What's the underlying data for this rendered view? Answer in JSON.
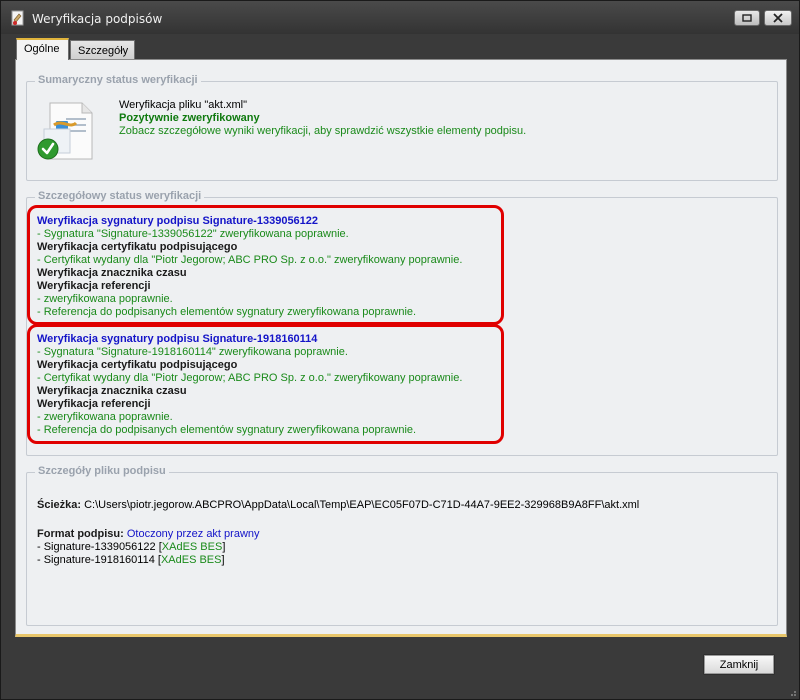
{
  "window": {
    "title": "Weryfikacja podpisów"
  },
  "tabs": [
    {
      "label": "Ogólne",
      "active": true
    },
    {
      "label": "Szczegóły",
      "active": false
    }
  ],
  "summary": {
    "legend": "Sumaryczny status weryfikacji",
    "file_line": "Weryfikacja pliku \"akt.xml\"",
    "status": "Pozytywnie zweryfikowany",
    "hint": "Zobacz szczegółowe wyniki weryfikacji, aby sprawdzić wszystkie elementy podpisu."
  },
  "details": {
    "legend": "Szczegółowy status weryfikacji",
    "signatures": [
      {
        "heading": "Weryfikacja sygnatury podpisu Signature-1339056122",
        "sig_result": " - Sygnatura \"Signature-1339056122\" zweryfikowana poprawnie.",
        "cert_heading": "Weryfikacja certyfikatu podpisującego",
        "cert_result": " - Certyfikat wydany dla \"Piotr Jegorow; ABC PRO Sp. z o.o.\" zweryfikowany poprawnie.",
        "timestamp_heading": "Weryfikacja znacznika czasu",
        "ref_heading": "Weryfikacja referencji",
        "ref_result1": " -  zweryfikowana poprawnie.",
        "ref_result2": " - Referencja do podpisanych elementów sygnatury zweryfikowana poprawnie."
      },
      {
        "heading": "Weryfikacja sygnatury podpisu Signature-1918160114",
        "sig_result": " - Sygnatura \"Signature-1918160114\" zweryfikowana poprawnie.",
        "cert_heading": "Weryfikacja certyfikatu podpisującego",
        "cert_result": " - Certyfikat wydany dla \"Piotr Jegorow; ABC PRO Sp. z o.o.\" zweryfikowany poprawnie.",
        "timestamp_heading": "Weryfikacja znacznika czasu",
        "ref_heading": "Weryfikacja referencji",
        "ref_result1": " -  zweryfikowana poprawnie.",
        "ref_result2": " - Referencja do podpisanych elementów sygnatury zweryfikowana poprawnie."
      }
    ]
  },
  "file_details": {
    "legend": "Szczegóły pliku podpisu",
    "path_label": "Ścieżka:",
    "path_value": " C:\\Users\\piotr.jegorow.ABCPRO\\AppData\\Local\\Temp\\EAP\\EC05F07D-C71D-44A7-9EE2-329968B9A8FF\\akt.xml",
    "format_label": "Format podpisu:",
    "format_value": " Otoczony przez akt prawny",
    "entries": [
      {
        "name": " - Signature-1339056122 ",
        "open": "[",
        "type": "XAdES BES",
        "close": "]"
      },
      {
        "name": " - Signature-1918160114 ",
        "open": "[",
        "type": "XAdES BES",
        "close": "]"
      }
    ]
  },
  "buttons": {
    "close_label": "Zamknij"
  },
  "colors": {
    "ok_green": "#1a8a1a",
    "link_blue": "#1414c8",
    "highlight_red": "#e00000",
    "tab_accent": "#e0b43c"
  },
  "icons": {
    "app": "signature-app-icon",
    "document": "verified-document-icon",
    "restore": "restore-icon",
    "close": "close-icon"
  }
}
